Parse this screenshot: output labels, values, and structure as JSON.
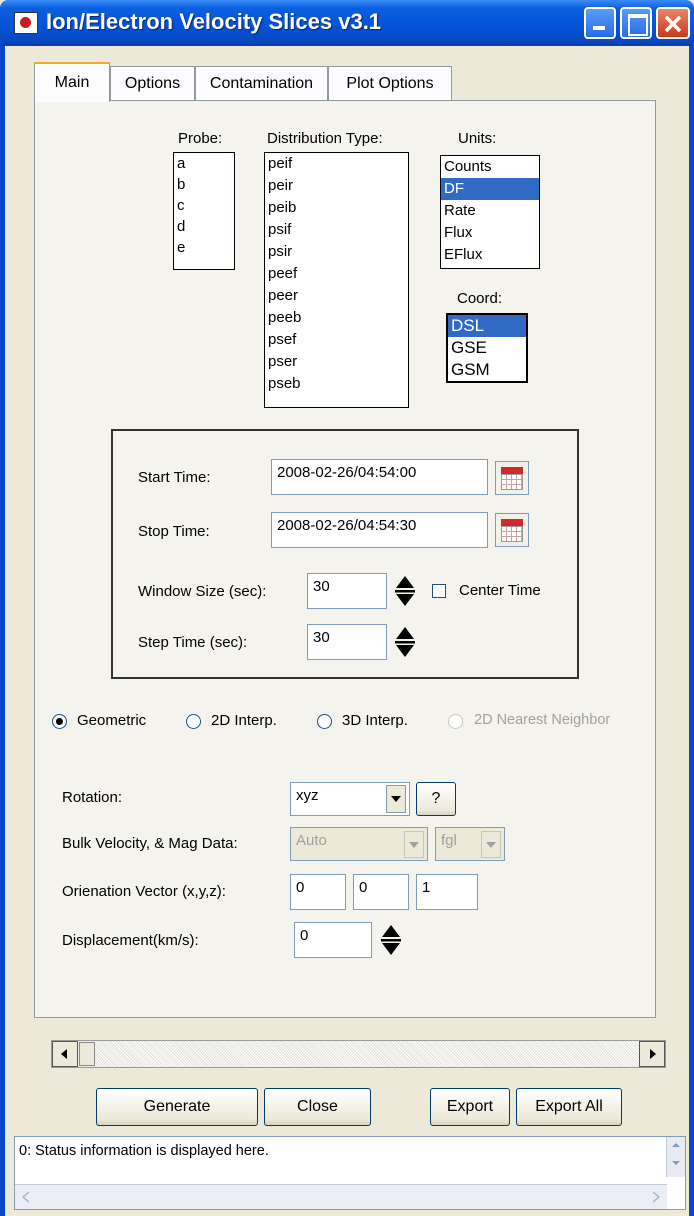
{
  "window": {
    "title": "Ion/Electron Velocity Slices v3.1"
  },
  "tabs": [
    {
      "label": "Main",
      "active": true
    },
    {
      "label": "Options"
    },
    {
      "label": "Contamination"
    },
    {
      "label": "Plot Options"
    }
  ],
  "probe": {
    "label": "Probe:",
    "items": [
      "a",
      "b",
      "c",
      "d",
      "e"
    ]
  },
  "distribution": {
    "label": "Distribution Type:",
    "items": [
      "peif",
      "peir",
      "peib",
      "psif",
      "psir",
      "peef",
      "peer",
      "peeb",
      "psef",
      "pser",
      "pseb"
    ]
  },
  "units": {
    "label": "Units:",
    "items": [
      "Counts",
      "DF",
      "Rate",
      "Flux",
      "EFlux"
    ],
    "selected": "DF"
  },
  "coord": {
    "label": "Coord:",
    "items": [
      "DSL",
      "GSE",
      "GSM"
    ],
    "selected": "DSL"
  },
  "time": {
    "start_label": "Start Time:",
    "start_value": "2008-02-26/04:54:00",
    "stop_label": "Stop Time:",
    "stop_value": "2008-02-26/04:54:30",
    "window_label": "Window Size (sec):",
    "window_value": "30",
    "center_label": "Center Time",
    "step_label": "Step Time (sec):",
    "step_value": "30"
  },
  "method": {
    "options": [
      "Geometric",
      "2D Interp.",
      "3D Interp.",
      "2D Nearest Neighbor"
    ],
    "selected": "Geometric"
  },
  "rotation": {
    "label": "Rotation:",
    "value": "xyz",
    "help": "?"
  },
  "bulk": {
    "label": "Bulk Velocity, & Mag Data:",
    "value": "Auto",
    "mag": "fgl"
  },
  "orientation": {
    "label": "Orienation Vector (x,y,z):",
    "x": "0",
    "y": "0",
    "z": "1"
  },
  "displacement": {
    "label": "Displacement(km/s):",
    "value": "0"
  },
  "buttons": {
    "generate": "Generate",
    "close": "Close",
    "export": "Export",
    "export_all": "Export All"
  },
  "status": {
    "text": "0: Status information is displayed here."
  },
  "colors": {
    "titlebar": "#0552d6",
    "selection": "#316ac5",
    "tab_accent": "#f3a92b"
  }
}
